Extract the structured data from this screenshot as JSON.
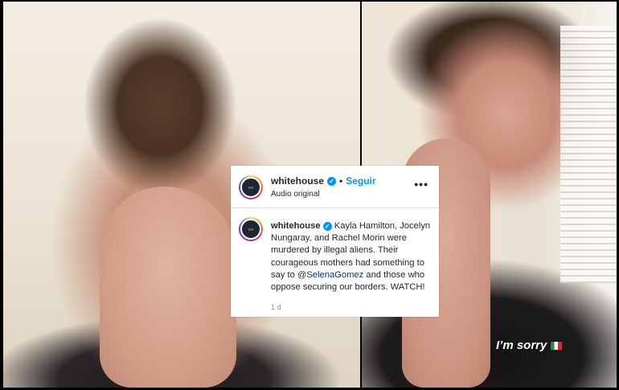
{
  "post": {
    "username": "whitehouse",
    "follow_label": "Seguir",
    "separator": "•",
    "audio_label": "Audio original",
    "more_label": "•••",
    "avatar_text": "WH",
    "caption": {
      "username": "whitehouse",
      "text_before_mention": " Kayla Hamilton, Jocelyn Nungaray, and Rachel Morin were murdered by illegal aliens. Their courageous mothers had something to say to ",
      "mention": "@SelenaGomez",
      "text_after_mention": " and those who oppose securing our borders. WATCH!"
    },
    "time_ago": "1 d",
    "verified_glyph": "✓"
  },
  "video_overlay": {
    "caption": "I’m sorry",
    "flag_icon": "mexico-flag-icon"
  },
  "colors": {
    "accent_blue": "#0095f6",
    "mention_blue": "#00376b",
    "text_primary": "#262626",
    "text_secondary": "#8e8e8e"
  }
}
